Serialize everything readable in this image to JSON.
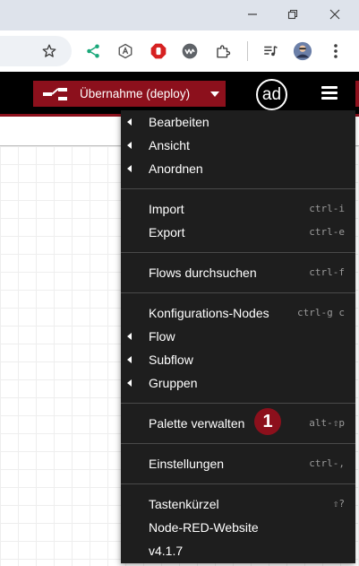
{
  "deploy": {
    "label": "Übernahme (deploy)"
  },
  "avatar": {
    "text": "ad"
  },
  "menu": {
    "items": [
      {
        "label": "Bearbeiten",
        "submenu": true,
        "shortcut": ""
      },
      {
        "label": "Ansicht",
        "submenu": true,
        "shortcut": ""
      },
      {
        "label": "Anordnen",
        "submenu": true,
        "shortcut": ""
      },
      {
        "label": "Import",
        "submenu": false,
        "shortcut": "ctrl-i"
      },
      {
        "label": "Export",
        "submenu": false,
        "shortcut": "ctrl-e"
      },
      {
        "label": "Flows durchsuchen",
        "submenu": false,
        "shortcut": "ctrl-f"
      },
      {
        "label": "Konfigurations-Nodes",
        "submenu": false,
        "shortcut": "ctrl-g c"
      },
      {
        "label": "Flow",
        "submenu": true,
        "shortcut": ""
      },
      {
        "label": "Subflow",
        "submenu": true,
        "shortcut": ""
      },
      {
        "label": "Gruppen",
        "submenu": true,
        "shortcut": ""
      },
      {
        "label": "Palette verwalten",
        "submenu": false,
        "shortcut": "alt-⇧p"
      },
      {
        "label": "Einstellungen",
        "submenu": false,
        "shortcut": "ctrl-,"
      },
      {
        "label": "Tastenkürzel",
        "submenu": false,
        "shortcut": "⇧?"
      },
      {
        "label": "Node-RED-Website",
        "submenu": false,
        "shortcut": ""
      },
      {
        "label": "v4.1.7",
        "submenu": false,
        "shortcut": ""
      }
    ]
  },
  "annotation": {
    "badge": "1"
  },
  "colors": {
    "accent": "#8c101c",
    "menu_bg": "#1e1e1e",
    "header_bg": "#000000"
  },
  "icons": {
    "window": [
      "minimize-icon",
      "restore-icon",
      "close-icon"
    ],
    "toolbar": [
      "bookmark-star-icon",
      "share-icon",
      "extension-a-icon",
      "stop-hand-icon",
      "wave-icon",
      "puzzle-icon",
      "media-queue-icon",
      "profile-avatar-icon",
      "kebab-menu-icon"
    ]
  }
}
